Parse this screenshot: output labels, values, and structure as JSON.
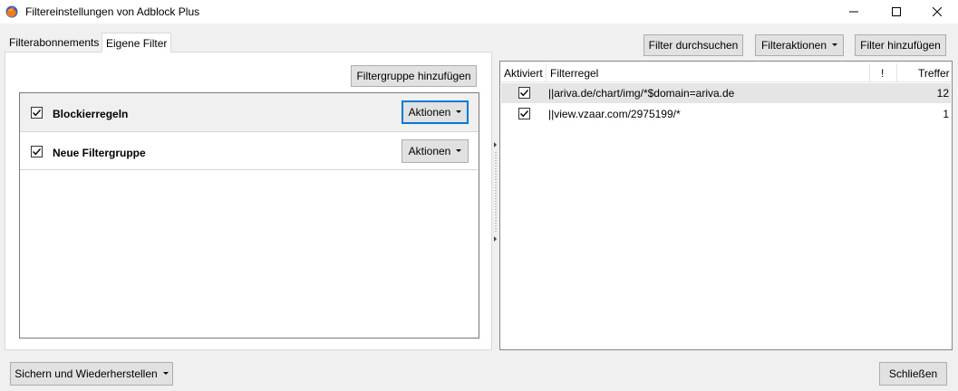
{
  "window": {
    "title": "Filtereinstellungen von Adblock Plus"
  },
  "tabs": [
    {
      "label": "Filterabonnements",
      "active": false
    },
    {
      "label": "Eigene Filter",
      "active": true
    }
  ],
  "toolbar": {
    "search_label": "Filter durchsuchen",
    "actions_label": "Filteraktionen",
    "add_filter_label": "Filter hinzufügen"
  },
  "left_panel": {
    "add_group_label": "Filtergruppe hinzufügen",
    "groups": [
      {
        "name": "Blockierregeln",
        "checked": true,
        "actions_label": "Aktionen",
        "selected": true
      },
      {
        "name": "Neue Filtergruppe",
        "checked": true,
        "actions_label": "Aktionen",
        "selected": false
      }
    ]
  },
  "filter_table": {
    "columns": [
      "Aktiviert",
      "Filterregel",
      "!",
      "Treffer"
    ],
    "rows": [
      {
        "enabled": true,
        "rule": "||ariva.de/chart/img/*$domain=ariva.de",
        "hits": "12",
        "selected": true
      },
      {
        "enabled": true,
        "rule": "||view.vzaar.com/2975199/*",
        "hits": "1",
        "selected": false
      }
    ]
  },
  "footer": {
    "backup_label": "Sichern und Wiederherstellen",
    "close_label": "Schließen"
  },
  "colors": {
    "focus_border": "#0078d7",
    "selection": "#e5e5e5"
  }
}
